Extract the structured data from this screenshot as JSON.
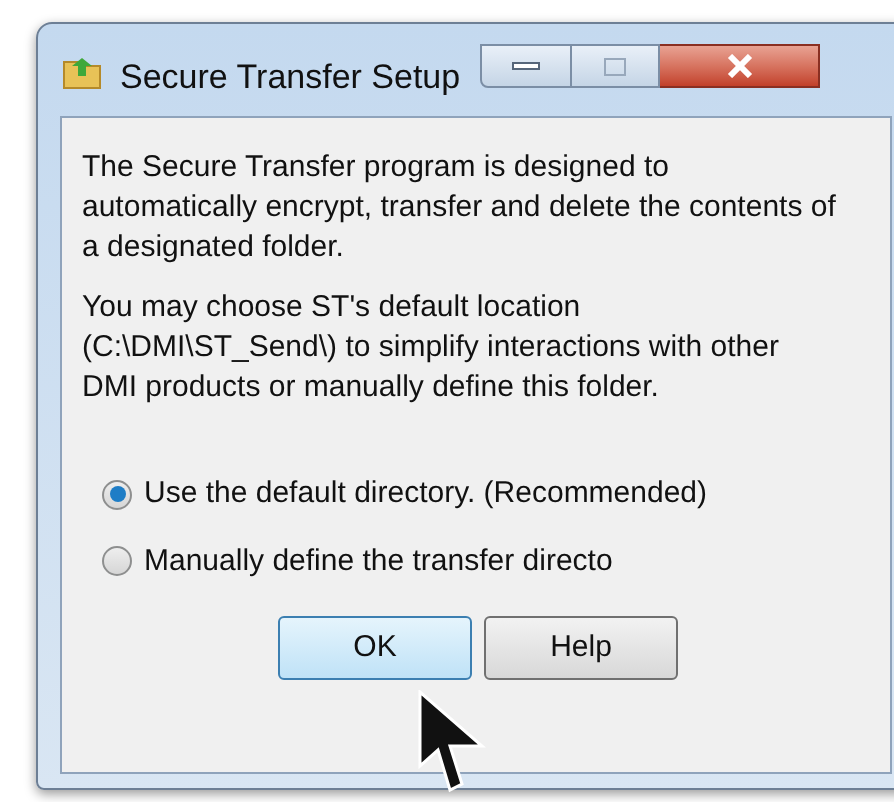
{
  "window": {
    "title": "Secure Transfer Setup"
  },
  "paragraphs": [
    "The Secure Transfer program is designed to automatically encrypt, transfer and delete the contents of a designated folder.",
    "You may choose ST's default location (C:\\DMI\\ST_Send\\) to simplify interactions with other DMI products or manually define this folder."
  ],
  "options": [
    {
      "label": "Use the default directory.  (Recommended)",
      "selected": true
    },
    {
      "label": "Manually define the transfer directo",
      "selected": false
    }
  ],
  "buttons": [
    {
      "label": "OK",
      "focused": true
    },
    {
      "label": "Help",
      "focused": false
    }
  ]
}
